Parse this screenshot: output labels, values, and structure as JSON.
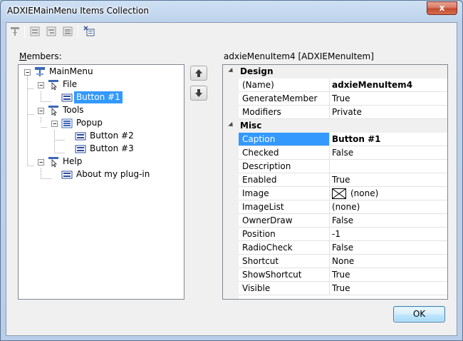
{
  "window": {
    "title": "ADXIEMainMenu Items Collection",
    "close_glyph": "x"
  },
  "toolbar": {
    "buttons": [
      "add-root-item-icon",
      "add-item-icon",
      "add-sub-item-icon",
      "add-separator-icon",
      "delete-icon"
    ]
  },
  "members": {
    "label_accel": "M",
    "label_rest": "embers:",
    "tree": [
      {
        "label": "MainMenu",
        "icon": "main-menu-icon"
      },
      {
        "label": "File",
        "icon": "popup-icon"
      },
      {
        "label": "Button #1",
        "icon": "button-icon",
        "selected": true
      },
      {
        "label": "Tools",
        "icon": "popup-icon"
      },
      {
        "label": "Popup",
        "icon": "submenu-icon"
      },
      {
        "label": "Button #2",
        "icon": "button-icon"
      },
      {
        "label": "Button #3",
        "icon": "button-icon"
      },
      {
        "label": "Help",
        "icon": "popup-icon"
      },
      {
        "label": "About my plug-in",
        "icon": "button-icon"
      }
    ]
  },
  "properties": {
    "header": "adxieMenuItem4 [ADXIEMenuItem]",
    "categories": [
      {
        "name": "Design",
        "rows": [
          {
            "name": "(Name)",
            "value": "adxieMenuItem4",
            "bold": true
          },
          {
            "name": "GenerateMember",
            "value": "True"
          },
          {
            "name": "Modifiers",
            "value": "Private"
          }
        ]
      },
      {
        "name": "Misc",
        "rows": [
          {
            "name": "Caption",
            "value": "Button #1",
            "bold": true,
            "selected": true
          },
          {
            "name": "Checked",
            "value": "False"
          },
          {
            "name": "Description",
            "value": ""
          },
          {
            "name": "Enabled",
            "value": "True"
          },
          {
            "name": "Image",
            "value": "(none)"
          },
          {
            "name": "ImageList",
            "value": "(none)"
          },
          {
            "name": "OwnerDraw",
            "value": "False"
          },
          {
            "name": "Position",
            "value": "-1"
          },
          {
            "name": "RadioCheck",
            "value": "False"
          },
          {
            "name": "Shortcut",
            "value": "None"
          },
          {
            "name": "ShowShortcut",
            "value": "True"
          },
          {
            "name": "Visible",
            "value": "True"
          }
        ]
      }
    ]
  },
  "ok_label": "OK"
}
